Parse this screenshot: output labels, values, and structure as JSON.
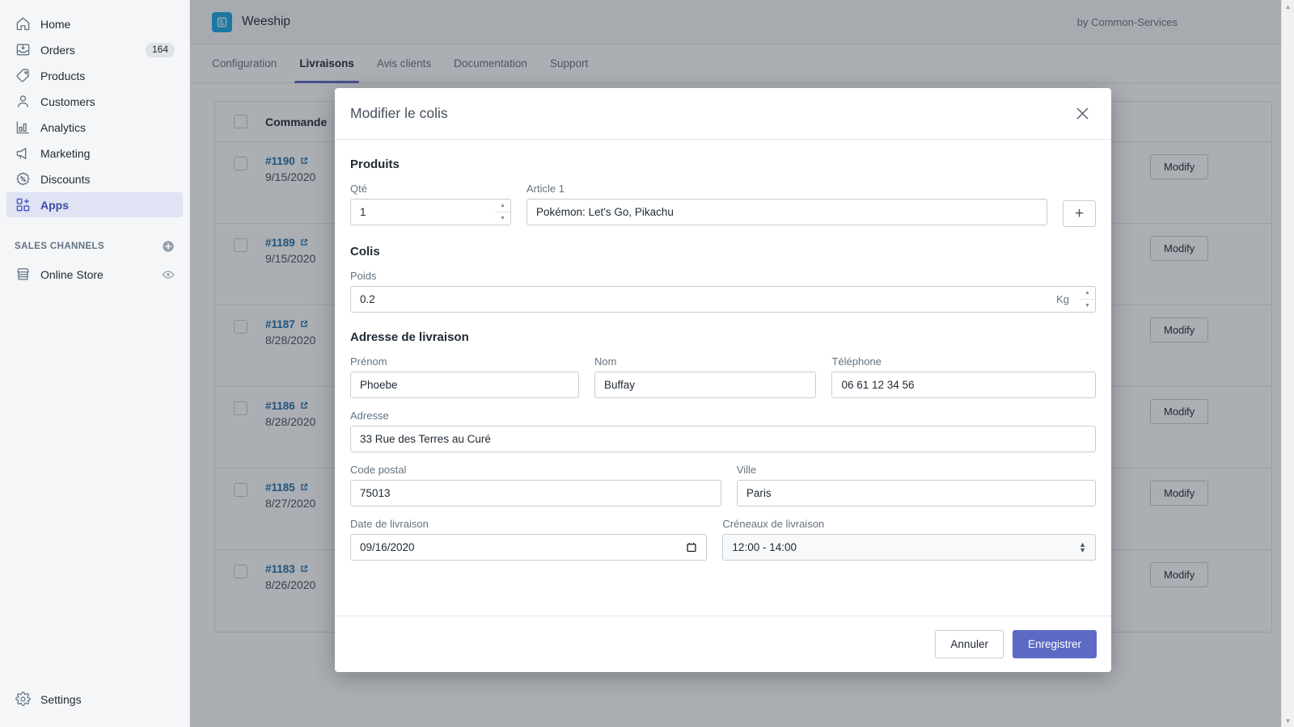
{
  "sidebar": {
    "items": [
      {
        "label": "Home",
        "icon": "home-icon",
        "badge": null
      },
      {
        "label": "Orders",
        "icon": "orders-icon",
        "badge": "164"
      },
      {
        "label": "Products",
        "icon": "products-tag-icon",
        "badge": null
      },
      {
        "label": "Customers",
        "icon": "customers-person-icon",
        "badge": null
      },
      {
        "label": "Analytics",
        "icon": "analytics-bars-icon",
        "badge": null
      },
      {
        "label": "Marketing",
        "icon": "marketing-megaphone-icon",
        "badge": null
      },
      {
        "label": "Discounts",
        "icon": "discounts-percent-icon",
        "badge": null
      },
      {
        "label": "Apps",
        "icon": "apps-grid-plus-icon",
        "badge": null
      }
    ],
    "active_item": "Apps",
    "section_title": "SALES CHANNELS",
    "channels": [
      {
        "label": "Online Store",
        "icon": "storefront-icon"
      }
    ],
    "footer": {
      "label": "Settings",
      "icon": "gear-icon"
    }
  },
  "header": {
    "app_name": "Weeship",
    "logo_icon": "weeship-logo-icon",
    "logo_color": "#19a8e6",
    "by_line": "by Common-Services"
  },
  "tabs": {
    "items": [
      "Configuration",
      "Livraisons",
      "Avis clients",
      "Documentation",
      "Support"
    ],
    "active": "Livraisons",
    "accent_color": "#5c6ac4"
  },
  "table": {
    "columns": [
      "",
      "Commande",
      "",
      ""
    ],
    "header_label": "Commande",
    "action_label": "Modify",
    "rows": [
      {
        "order": "#1190",
        "date": "9/15/2020"
      },
      {
        "order": "#1189",
        "date": "9/15/2020"
      },
      {
        "order": "#1187",
        "date": "8/28/2020"
      },
      {
        "order": "#1186",
        "date": "8/28/2020"
      },
      {
        "order": "#1185",
        "date": "8/27/2020"
      },
      {
        "order": "#1183",
        "date": "8/26/2020"
      }
    ]
  },
  "modal": {
    "title": "Modifier le colis",
    "close_icon": "close-icon",
    "sections": {
      "produits": {
        "title": "Produits",
        "qty_label": "Qté",
        "qty_value": "1",
        "article_label": "Article 1",
        "article_value": "Pokémon: Let's Go, Pikachu",
        "add_label": "+"
      },
      "colis": {
        "title": "Colis",
        "poids_label": "Poids",
        "poids_value": "0.2",
        "poids_unit": "Kg"
      },
      "adresse": {
        "title": "Adresse de livraison",
        "prenom_label": "Prénom",
        "prenom_value": "Phoebe",
        "nom_label": "Nom",
        "nom_value": "Buffay",
        "tel_label": "Téléphone",
        "tel_value": "06 61 12 34 56",
        "adresse_label": "Adresse",
        "adresse_value": "33 Rue des Terres au Curé",
        "cp_label": "Code postal",
        "cp_value": "75013",
        "ville_label": "Ville",
        "ville_value": "Paris",
        "date_label": "Date de livraison",
        "date_value": "09/16/2020",
        "creneaux_label": "Créneaux de livraison",
        "creneaux_value": "12:00 - 14:00",
        "creneaux_options": [
          "12:00 - 14:00"
        ]
      }
    },
    "footer": {
      "cancel_label": "Annuler",
      "save_label": "Enregistrer",
      "save_color": "#5c6ac4"
    }
  }
}
